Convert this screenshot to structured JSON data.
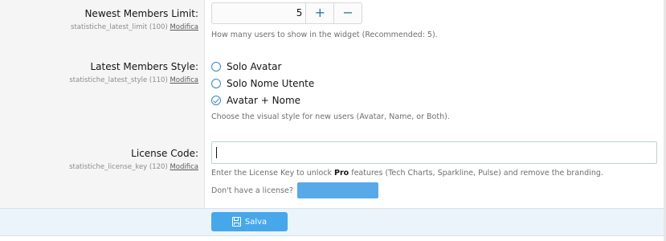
{
  "settings": {
    "limit": {
      "title": "Newest Members Limit:",
      "sub_key": "statistiche_latest_limit (100)",
      "edit_label": "Modifica",
      "value": "5",
      "increment": "+",
      "decrement": "−",
      "hint": "How many users to show in the widget (Recommended: 5)."
    },
    "style": {
      "title": "Latest Members Style:",
      "sub_key": "statistiche_latest_style (110)",
      "edit_label": "Modifica",
      "options": [
        {
          "label": "Solo Avatar",
          "checked": false
        },
        {
          "label": "Solo Nome Utente",
          "checked": false
        },
        {
          "label": "Avatar + Nome",
          "checked": true
        }
      ],
      "hint": "Choose the visual style for new users (Avatar, Name, or Both)."
    },
    "license": {
      "title": "License Code:",
      "sub_key": "statistiche_license_key (120)",
      "edit_label": "Modifica",
      "value": "",
      "hint_before": "Enter the License Key to unlock ",
      "hint_bold": "Pro",
      "hint_after": " features (Tech Charts, Sparkline, Pulse) and remove the branding.",
      "no_license_text": "Don't have a license?"
    }
  },
  "footer": {
    "save_label": "Salva",
    "save_icon": "save-icon"
  }
}
